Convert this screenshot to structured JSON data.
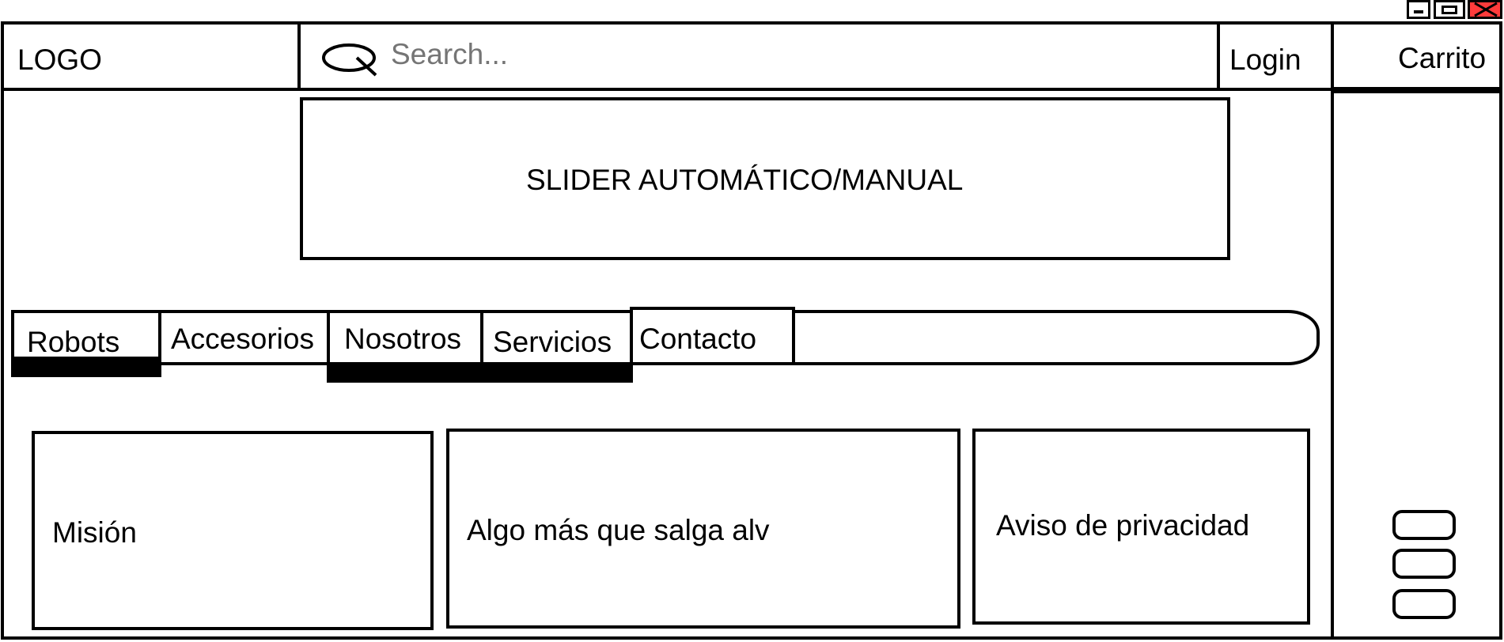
{
  "window": {
    "controls": [
      {
        "name": "minimize-icon",
        "glyph": "▁"
      },
      {
        "name": "maximize-icon",
        "glyph": "□"
      },
      {
        "name": "close-icon",
        "glyph": "✕"
      }
    ]
  },
  "header": {
    "logo": "LOGO",
    "search": {
      "placeholder": "Search...",
      "icon": "search-icon"
    },
    "login": "Login",
    "cart": "Carrito"
  },
  "slider": {
    "label": "SLIDER AUTOMÁTICO/MANUAL"
  },
  "nav": {
    "tabs": [
      {
        "label": "Robots",
        "active": true
      },
      {
        "label": "Accesorios",
        "active": false
      },
      {
        "label": "Nosotros",
        "active": true
      },
      {
        "label": "Servicios",
        "active": true
      },
      {
        "label": "Contacto",
        "active": false
      }
    ]
  },
  "cards": [
    {
      "label": "Misión"
    },
    {
      "label": "Algo más que salga alv"
    },
    {
      "label": "Aviso de privacidad"
    }
  ],
  "sidebar": {
    "buttons": [
      "sidebar-button-1",
      "sidebar-button-2",
      "sidebar-button-3"
    ]
  },
  "colors": {
    "stroke": "#000000",
    "background": "#ffffff",
    "close": "#ff3b3b"
  }
}
